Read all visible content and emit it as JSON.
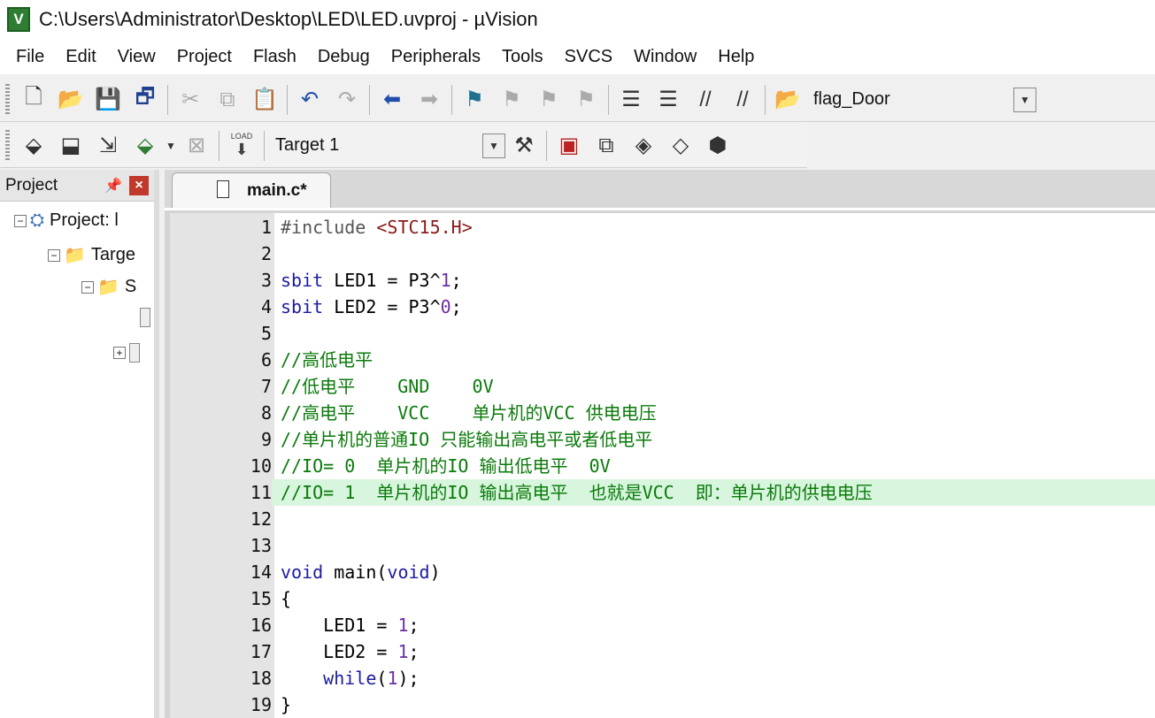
{
  "window": {
    "title": "C:\\Users\\Administrator\\Desktop\\LED\\LED.uvproj - µVision",
    "icon_text": "V"
  },
  "menu": [
    "File",
    "Edit",
    "View",
    "Project",
    "Flash",
    "Debug",
    "Peripherals",
    "Tools",
    "SVCS",
    "Window",
    "Help"
  ],
  "toolbar1": {
    "find_value": "flag_Door"
  },
  "toolbar2": {
    "target_value": "Target 1",
    "load_label": "LOAD"
  },
  "project_panel": {
    "title": "Project",
    "tree": [
      {
        "label": "Project: l",
        "expander": "−"
      },
      {
        "label": "Targe",
        "expander": "−"
      },
      {
        "label": "S",
        "expander": "−"
      },
      {
        "label": "",
        "expander": ""
      },
      {
        "label": "",
        "expander": "+"
      }
    ]
  },
  "editor": {
    "tab_label": "main.c*",
    "current_line": 13,
    "highlight_line": 11,
    "lines": [
      {
        "n": "1",
        "segs": [
          {
            "t": "#include ",
            "c": "pp"
          },
          {
            "t": "<STC15.H>",
            "c": "str"
          }
        ]
      },
      {
        "n": "2",
        "segs": []
      },
      {
        "n": "3",
        "segs": [
          {
            "t": "sbit",
            "c": "kw"
          },
          {
            "t": " LED1 = P3^",
            "c": ""
          },
          {
            "t": "1",
            "c": "num"
          },
          {
            "t": ";",
            "c": ""
          }
        ]
      },
      {
        "n": "4",
        "segs": [
          {
            "t": "sbit",
            "c": "kw"
          },
          {
            "t": " LED2 = P3^",
            "c": ""
          },
          {
            "t": "0",
            "c": "num"
          },
          {
            "t": ";",
            "c": ""
          }
        ]
      },
      {
        "n": "5",
        "segs": []
      },
      {
        "n": "6",
        "segs": [
          {
            "t": "//高低电平",
            "c": "cm"
          }
        ]
      },
      {
        "n": "7",
        "segs": [
          {
            "t": "//低电平    GND    0V",
            "c": "cm"
          }
        ]
      },
      {
        "n": "8",
        "segs": [
          {
            "t": "//高电平    VCC    单片机的VCC 供电电压",
            "c": "cm"
          }
        ]
      },
      {
        "n": "9",
        "segs": [
          {
            "t": "//单片机的普通IO 只能输出高电平或者低电平",
            "c": "cm"
          }
        ]
      },
      {
        "n": "10",
        "segs": [
          {
            "t": "//IO= 0  单片机的IO 输出低电平  0V",
            "c": "cm"
          }
        ]
      },
      {
        "n": "11",
        "segs": [
          {
            "t": "//IO= 1  单片机的IO 输出高电平  也就是VCC  即：单片机的供电电压",
            "c": "cm"
          }
        ]
      },
      {
        "n": "12",
        "segs": []
      },
      {
        "n": "13",
        "segs": []
      },
      {
        "n": "14",
        "segs": [
          {
            "t": "void",
            "c": "kw"
          },
          {
            "t": " main(",
            "c": ""
          },
          {
            "t": "void",
            "c": "kw"
          },
          {
            "t": ")",
            "c": ""
          }
        ]
      },
      {
        "n": "15",
        "segs": [
          {
            "t": "{",
            "c": ""
          }
        ]
      },
      {
        "n": "16",
        "segs": [
          {
            "t": "    LED1 = ",
            "c": ""
          },
          {
            "t": "1",
            "c": "num"
          },
          {
            "t": ";",
            "c": ""
          }
        ]
      },
      {
        "n": "17",
        "segs": [
          {
            "t": "    LED2 = ",
            "c": ""
          },
          {
            "t": "1",
            "c": "num"
          },
          {
            "t": ";",
            "c": ""
          }
        ]
      },
      {
        "n": "18",
        "segs": [
          {
            "t": "    ",
            "c": ""
          },
          {
            "t": "while",
            "c": "kw"
          },
          {
            "t": "(",
            "c": ""
          },
          {
            "t": "1",
            "c": "num"
          },
          {
            "t": ");",
            "c": ""
          }
        ]
      },
      {
        "n": "19",
        "segs": [
          {
            "t": "}",
            "c": ""
          }
        ]
      }
    ]
  }
}
